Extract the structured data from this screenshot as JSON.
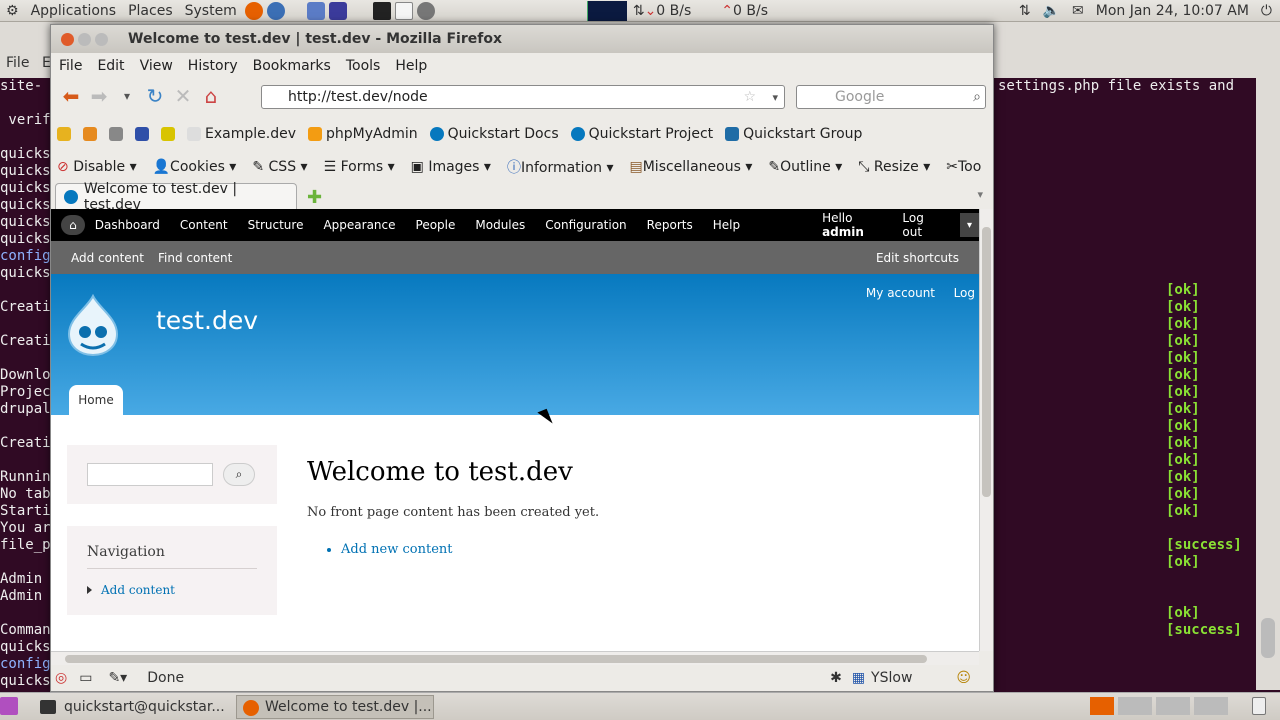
{
  "top_panel": {
    "menus": [
      "Applications",
      "Places",
      "System"
    ],
    "net_down": "0 B/s",
    "net_up": "0 B/s",
    "clock": "Mon Jan 24, 10:07 AM"
  },
  "terminal": {
    "menu": [
      "File",
      "E"
    ],
    "left_lines": [
      "site-",
      "",
      " verif",
      "",
      "quicks",
      "quicks",
      "quicks",
      "quicks",
      "quicks",
      "quicks",
      "config",
      "quicks",
      "",
      "Creati",
      "",
      "Creati",
      "",
      "Downlo",
      "Projec",
      "drupal",
      "",
      "Creati",
      "",
      "Runnin",
      "No tab",
      "Starti",
      "You ar",
      "file_p",
      "",
      "Admin",
      "Admin",
      "",
      "Comman",
      "quicks",
      "config",
      "quicks"
    ],
    "right_text": "settings.php file exists and",
    "status_lines": [
      "[ok]",
      "[ok]",
      "[ok]",
      "[ok]",
      "[ok]",
      "[ok]",
      "[ok]",
      "[ok]",
      "[ok]",
      "[ok]",
      "[ok]",
      "[ok]",
      "[ok]",
      "[ok]",
      "",
      "[success]",
      "[ok]",
      "",
      "",
      "[ok]",
      "[success]"
    ]
  },
  "firefox": {
    "title": "Welcome to test.dev | test.dev - Mozilla Firefox",
    "menu": [
      "File",
      "Edit",
      "View",
      "History",
      "Bookmarks",
      "Tools",
      "Help"
    ],
    "url": "http://test.dev/node",
    "search_placeholder": "Google",
    "bookmarks": [
      "Example.dev",
      "phpMyAdmin",
      "Quickstart Docs",
      "Quickstart Project",
      "Quickstart Group"
    ],
    "webdev": [
      "Disable",
      "Cookies",
      "CSS",
      "Forms",
      "Images",
      "Information",
      "Miscellaneous",
      "Outline",
      "Resize",
      "Too"
    ],
    "tab_title": "Welcome to test.dev | test.dev",
    "status": "Done",
    "yslow": "YSlow"
  },
  "page": {
    "toolbar": [
      "Dashboard",
      "Content",
      "Structure",
      "Appearance",
      "People",
      "Modules",
      "Configuration",
      "Reports",
      "Help"
    ],
    "hello_prefix": "Hello",
    "hello_user": "admin",
    "logout": "Log out",
    "shortcuts": [
      "Add content",
      "Find content"
    ],
    "edit_shortcuts": "Edit shortcuts",
    "site_name": "test.dev",
    "my_account": "My account",
    "log_out_short": "Log",
    "home_tab": "Home",
    "nav_title": "Navigation",
    "nav_link": "Add content",
    "h1": "Welcome to test.dev",
    "message": "No front page content has been created yet.",
    "add_link": "Add new content"
  },
  "bottom_panel": {
    "tasks": [
      "quickstart@quickstar...",
      "Welcome to test.dev |..."
    ]
  }
}
